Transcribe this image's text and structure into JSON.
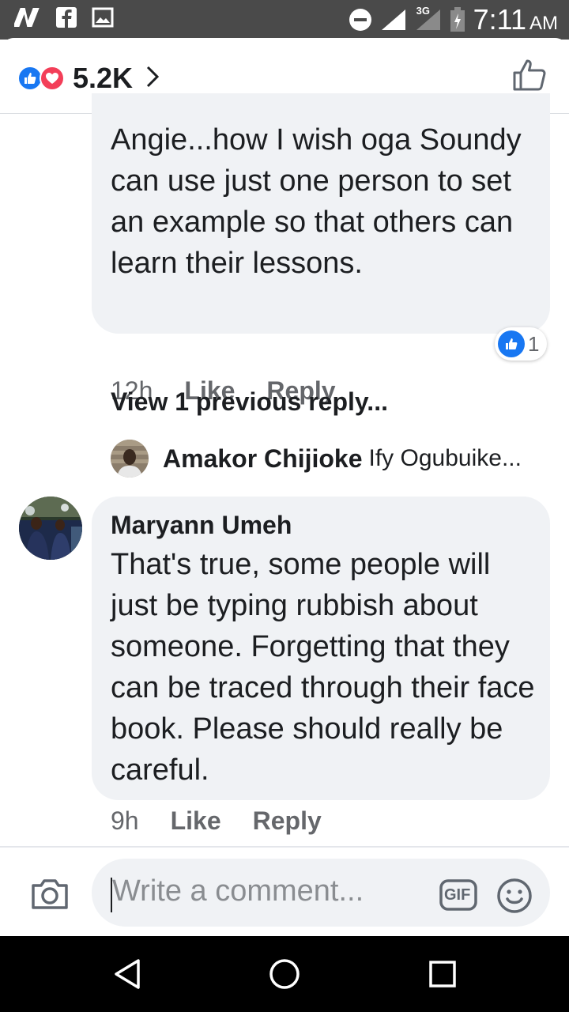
{
  "status_bar": {
    "time": "7:11",
    "ampm": "AM",
    "network": "3G",
    "icons": [
      "nairaland-icon",
      "facebook-icon",
      "gallery-icon",
      "do-not-disturb-icon",
      "signal-icon",
      "battery-icon"
    ]
  },
  "header": {
    "reaction_count": "5.2K",
    "reaction_icons": [
      "like-reaction-icon",
      "love-reaction-icon"
    ]
  },
  "comments": [
    {
      "text": "Angie...how I wish oga Soundy can use just one person to set an example so that others can learn their lessons.",
      "time": "12h",
      "like_label": "Like",
      "reply_label": "Reply",
      "reaction_count": "1"
    },
    {
      "author": "Maryann Umeh",
      "text": "That's true, some people will just be typing rubbish about someone. Forgetting that they can be traced through their face book. Please should really be careful.",
      "time": "9h",
      "like_label": "Like",
      "reply_label": "Reply"
    }
  ],
  "replies": {
    "view_previous": "View 1 previous reply...",
    "latest_author": "Amakor Chijioke",
    "latest_snippet": "Ify Ogubuike..."
  },
  "composer": {
    "placeholder": "Write a comment...",
    "gif_label": "GIF"
  },
  "colors": {
    "accent": "#1877f2",
    "love": "#f33e58",
    "bubble": "#f0f2f5",
    "meta_text": "#65676b"
  }
}
